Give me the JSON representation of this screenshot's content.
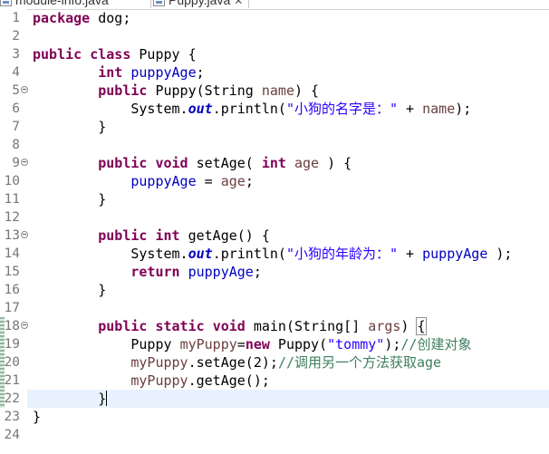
{
  "tabs": [
    {
      "label": "module-info.java",
      "active": false
    },
    {
      "label": "Puppy.java",
      "active": true,
      "close": "✕"
    }
  ],
  "editor": {
    "current_line": 22,
    "lines": [
      {
        "n": "1",
        "tokens": [
          {
            "t": "package",
            "c": "kw"
          },
          {
            "t": " dog;"
          }
        ]
      },
      {
        "n": "2",
        "tokens": []
      },
      {
        "n": "3",
        "tokens": [
          {
            "t": "public",
            "c": "kw"
          },
          {
            "t": " "
          },
          {
            "t": "class",
            "c": "kw"
          },
          {
            "t": " Puppy {"
          }
        ]
      },
      {
        "n": "4",
        "tokens": [
          {
            "t": "        "
          },
          {
            "t": "int",
            "c": "kw"
          },
          {
            "t": " "
          },
          {
            "t": "puppyAge",
            "c": "fld"
          },
          {
            "t": ";"
          }
        ]
      },
      {
        "n": "5",
        "fold": true,
        "tokens": [
          {
            "t": "        "
          },
          {
            "t": "public",
            "c": "kw"
          },
          {
            "t": " Puppy(String "
          },
          {
            "t": "name",
            "c": "par"
          },
          {
            "t": ") {"
          }
        ]
      },
      {
        "n": "6",
        "tokens": [
          {
            "t": "            System."
          },
          {
            "t": "out",
            "c": "sfld"
          },
          {
            "t": ".println("
          },
          {
            "t": "\"小狗的名字是：\"",
            "c": "str"
          },
          {
            "t": " + "
          },
          {
            "t": "name",
            "c": "par"
          },
          {
            "t": ");"
          }
        ]
      },
      {
        "n": "7",
        "tokens": [
          {
            "t": "        }"
          }
        ]
      },
      {
        "n": "8",
        "tokens": []
      },
      {
        "n": "9",
        "fold": true,
        "tokens": [
          {
            "t": "        "
          },
          {
            "t": "public",
            "c": "kw"
          },
          {
            "t": " "
          },
          {
            "t": "void",
            "c": "kw"
          },
          {
            "t": " setAge( "
          },
          {
            "t": "int",
            "c": "kw"
          },
          {
            "t": " "
          },
          {
            "t": "age",
            "c": "par"
          },
          {
            "t": " ) {"
          }
        ]
      },
      {
        "n": "10",
        "tokens": [
          {
            "t": "            "
          },
          {
            "t": "puppyAge",
            "c": "fld"
          },
          {
            "t": " = "
          },
          {
            "t": "age",
            "c": "par"
          },
          {
            "t": ";"
          }
        ]
      },
      {
        "n": "11",
        "tokens": [
          {
            "t": "        }"
          }
        ]
      },
      {
        "n": "12",
        "tokens": []
      },
      {
        "n": "13",
        "fold": true,
        "tokens": [
          {
            "t": "        "
          },
          {
            "t": "public",
            "c": "kw"
          },
          {
            "t": " "
          },
          {
            "t": "int",
            "c": "kw"
          },
          {
            "t": " getAge() {"
          }
        ]
      },
      {
        "n": "14",
        "tokens": [
          {
            "t": "            System."
          },
          {
            "t": "out",
            "c": "sfld"
          },
          {
            "t": ".println("
          },
          {
            "t": "\"小狗的年龄为：\"",
            "c": "str"
          },
          {
            "t": " + "
          },
          {
            "t": "puppyAge",
            "c": "fld"
          },
          {
            "t": " );"
          }
        ]
      },
      {
        "n": "15",
        "tokens": [
          {
            "t": "            "
          },
          {
            "t": "return",
            "c": "kw"
          },
          {
            "t": " "
          },
          {
            "t": "puppyAge",
            "c": "fld"
          },
          {
            "t": ";"
          }
        ]
      },
      {
        "n": "16",
        "tokens": [
          {
            "t": "        }"
          }
        ]
      },
      {
        "n": "17",
        "tokens": []
      },
      {
        "n": "18",
        "fold": true,
        "marker": true,
        "tokens": [
          {
            "t": "        "
          },
          {
            "t": "public",
            "c": "kw"
          },
          {
            "t": " "
          },
          {
            "t": "static",
            "c": "kw"
          },
          {
            "t": " "
          },
          {
            "t": "void",
            "c": "kw"
          },
          {
            "t": " main(String[] "
          },
          {
            "t": "args",
            "c": "par"
          },
          {
            "t": ") "
          },
          {
            "t": "{",
            "c": "brace"
          }
        ]
      },
      {
        "n": "19",
        "marker": true,
        "tokens": [
          {
            "t": "            Puppy "
          },
          {
            "t": "myPuppy",
            "c": "par"
          },
          {
            "t": "="
          },
          {
            "t": "new",
            "c": "kw"
          },
          {
            "t": " Puppy("
          },
          {
            "t": "\"tommy\"",
            "c": "str"
          },
          {
            "t": ");"
          },
          {
            "t": "//创建对象",
            "c": "cmt"
          }
        ]
      },
      {
        "n": "20",
        "marker": true,
        "tokens": [
          {
            "t": "            "
          },
          {
            "t": "myPuppy",
            "c": "par"
          },
          {
            "t": ".setAge(2);"
          },
          {
            "t": "//调用另一个方法获取age",
            "c": "cmt"
          }
        ]
      },
      {
        "n": "21",
        "marker": true,
        "tokens": [
          {
            "t": "            "
          },
          {
            "t": "myPuppy",
            "c": "par"
          },
          {
            "t": ".getAge();"
          }
        ]
      },
      {
        "n": "22",
        "marker": true,
        "caret": true,
        "tokens": [
          {
            "t": "        }"
          }
        ]
      },
      {
        "n": "23",
        "tokens": [
          {
            "t": "}"
          }
        ]
      },
      {
        "n": "24",
        "tokens": []
      }
    ]
  }
}
